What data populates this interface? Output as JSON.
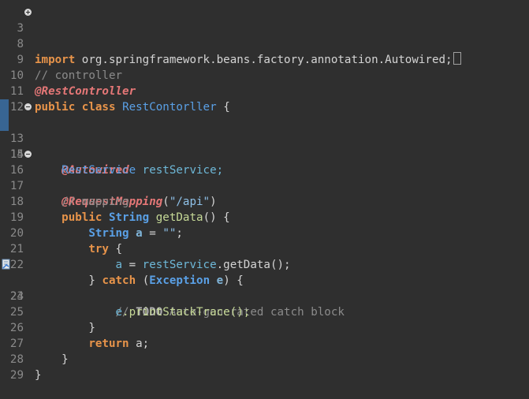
{
  "editor": {
    "lines": [
      {
        "num": "3",
        "fold": "plus"
      },
      {
        "num": "8"
      },
      {
        "num": "9"
      },
      {
        "num": "10"
      },
      {
        "num": "11"
      },
      {
        "num": "12"
      },
      {
        "num": "13",
        "fold": "minus",
        "marker": true
      },
      {
        "num": "14",
        "marker": true
      },
      {
        "num": "15"
      },
      {
        "num": "16",
        "fold": "minus"
      },
      {
        "num": "17"
      },
      {
        "num": "18"
      },
      {
        "num": "19"
      },
      {
        "num": "20"
      },
      {
        "num": "21"
      },
      {
        "num": "22"
      },
      {
        "num": "23",
        "quickfix": true
      },
      {
        "num": "24"
      },
      {
        "num": "25"
      },
      {
        "num": "26"
      },
      {
        "num": "27"
      },
      {
        "num": "28"
      },
      {
        "num": "29"
      }
    ],
    "tokens": {
      "import_kw": "import",
      "import_path": " org.springframework.beans.factory.annotation.Autowired;",
      "comment_controller": "// controller",
      "ann_restcontroller": "@RestController",
      "public_kw": "public",
      "class_kw": "class",
      "class_name": "RestContorller",
      "open_brace": " {",
      "ann_autowired": "@Autowired",
      "rest_service_type": "RestService",
      "rest_service_field": " restService;",
      "ann_request_mapping": "@RequestMapping",
      "mapping_args_open": "(",
      "mapping_string": "\"/api\"",
      "mapping_args_close": ")",
      "comment_mapping": "// mapping",
      "public_kw2": "public",
      "string_type": "String",
      "method_name": "getData",
      "method_sig_end": "() {",
      "string_type2": "String",
      "var_a": "a",
      "assign_empty": " = ",
      "empty_string": "\"\"",
      "semicolon": ";",
      "try_kw": "try",
      "try_brace": " {",
      "a_var2": "a",
      "assign2": " = ",
      "rest_service_ref": "restService",
      "dot_getdata": ".getData();",
      "close_catch": "} ",
      "catch_kw": "catch",
      "catch_open": " (",
      "exception_type": "Exception",
      "exception_var": "e",
      "catch_close": ") {",
      "todo_comment_prefix": "// ",
      "todo_tag": "TODO",
      "todo_text": " Auto-generated catch block",
      "e_var": "e",
      "print_stack": ".printStackTrace();",
      "close_brace_try": "}",
      "return_kw": "return",
      "return_var": " a;",
      "close_brace_method": "}",
      "close_brace_class": "}"
    }
  }
}
